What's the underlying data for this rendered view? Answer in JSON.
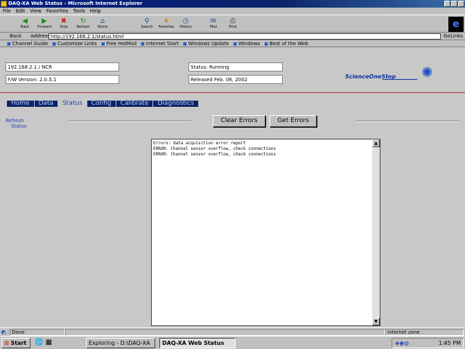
{
  "window": {
    "title": "DAQ-XA Web Status - Microsoft Internet Explorer"
  },
  "menu": [
    "File",
    "Edit",
    "View",
    "Favorites",
    "Tools",
    "Help"
  ],
  "toolbar": {
    "buttons": [
      {
        "label": "Back",
        "icon": "back-arrow-icon"
      },
      {
        "label": "Forward",
        "icon": "forward-arrow-icon"
      },
      {
        "label": "Stop",
        "icon": "stop-icon"
      },
      {
        "label": "Refresh",
        "icon": "refresh-icon"
      },
      {
        "label": "Home",
        "icon": "home-icon"
      },
      {
        "label": "Search",
        "icon": "search-icon"
      },
      {
        "label": "Favorites",
        "icon": "favorites-icon"
      },
      {
        "label": "History",
        "icon": "history-icon"
      },
      {
        "label": "Mail",
        "icon": "mail-icon"
      },
      {
        "label": "Print",
        "icon": "print-icon"
      }
    ]
  },
  "address": {
    "back_label": "Back",
    "label": "Address",
    "url": "http://192.168.2.1/status.html",
    "go": "Go",
    "links": "Links"
  },
  "links": [
    "Channel Guide",
    "Customize Links",
    "Free HotMail",
    "Internet Start",
    "Windows Update",
    "Windows",
    "Best of the Web"
  ],
  "info": {
    "f1": "192.168.2.1 / NCR",
    "f2": "Status: Running",
    "f3": "F/W Version: 2.0.5.1",
    "f4": "Released Feb. 06, 2002"
  },
  "brand": {
    "name": "ScienceOneStop",
    "logo": "starburst-logo"
  },
  "tabs": [
    "Home",
    "Data",
    "Status",
    "Config",
    "Calibrate",
    "Diagnostics"
  ],
  "active_tab": "Status",
  "leftnav": [
    "Refresh",
    "Status"
  ],
  "buttons": {
    "clear": "Clear Errors",
    "get": "Get Errors"
  },
  "log": {
    "lines": [
      "Errors: data acquisition error report",
      "ERROR: Channel sensor overflow, check connections",
      "ERROR: Channel sensor overflow, check connections"
    ]
  },
  "status": {
    "left": "Done",
    "middle": "Internet zone"
  },
  "taskbar": {
    "start": "Start",
    "items": [
      "Exploring - D:\\DAQ-XA",
      "DAQ-XA Web Status"
    ],
    "clock": "1:45 PM"
  }
}
